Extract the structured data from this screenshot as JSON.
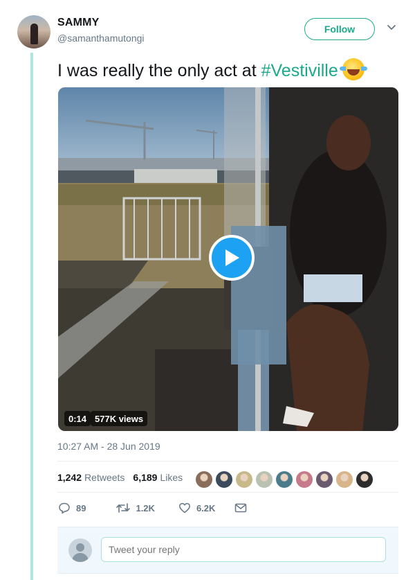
{
  "user": {
    "name": "SAMMY",
    "handle": "@samanthamutongi",
    "follow_label": "Follow"
  },
  "tweet": {
    "text": "I was really the only act at ",
    "hashtag": "#Vestiville",
    "emoji_name": "face-with-tears-of-joy-icon"
  },
  "video": {
    "duration": "0:14",
    "views": "577K views"
  },
  "meta": {
    "timestamp": "10:27 AM - 28 Jun 2019"
  },
  "stats": {
    "retweets_count": "1,242",
    "retweets_label": "Retweets",
    "likes_count": "6,189",
    "likes_label": "Likes",
    "liker_avatar_colors": [
      "#8a6d5a",
      "#3b4a5c",
      "#c7b98a",
      "#b9c2b0",
      "#4a7c8c",
      "#c77b8a",
      "#6a5a70",
      "#d8b48a",
      "#2d2d2d"
    ]
  },
  "actions": {
    "reply_count": "89",
    "retweet_count": "1.2K",
    "like_count": "6.2K"
  },
  "reply": {
    "placeholder": "Tweet your reply"
  },
  "colors": {
    "accent": "#1aaa8b",
    "play_button": "#1da1f2",
    "muted_text": "#657786",
    "thread_line": "#aee8dc"
  }
}
